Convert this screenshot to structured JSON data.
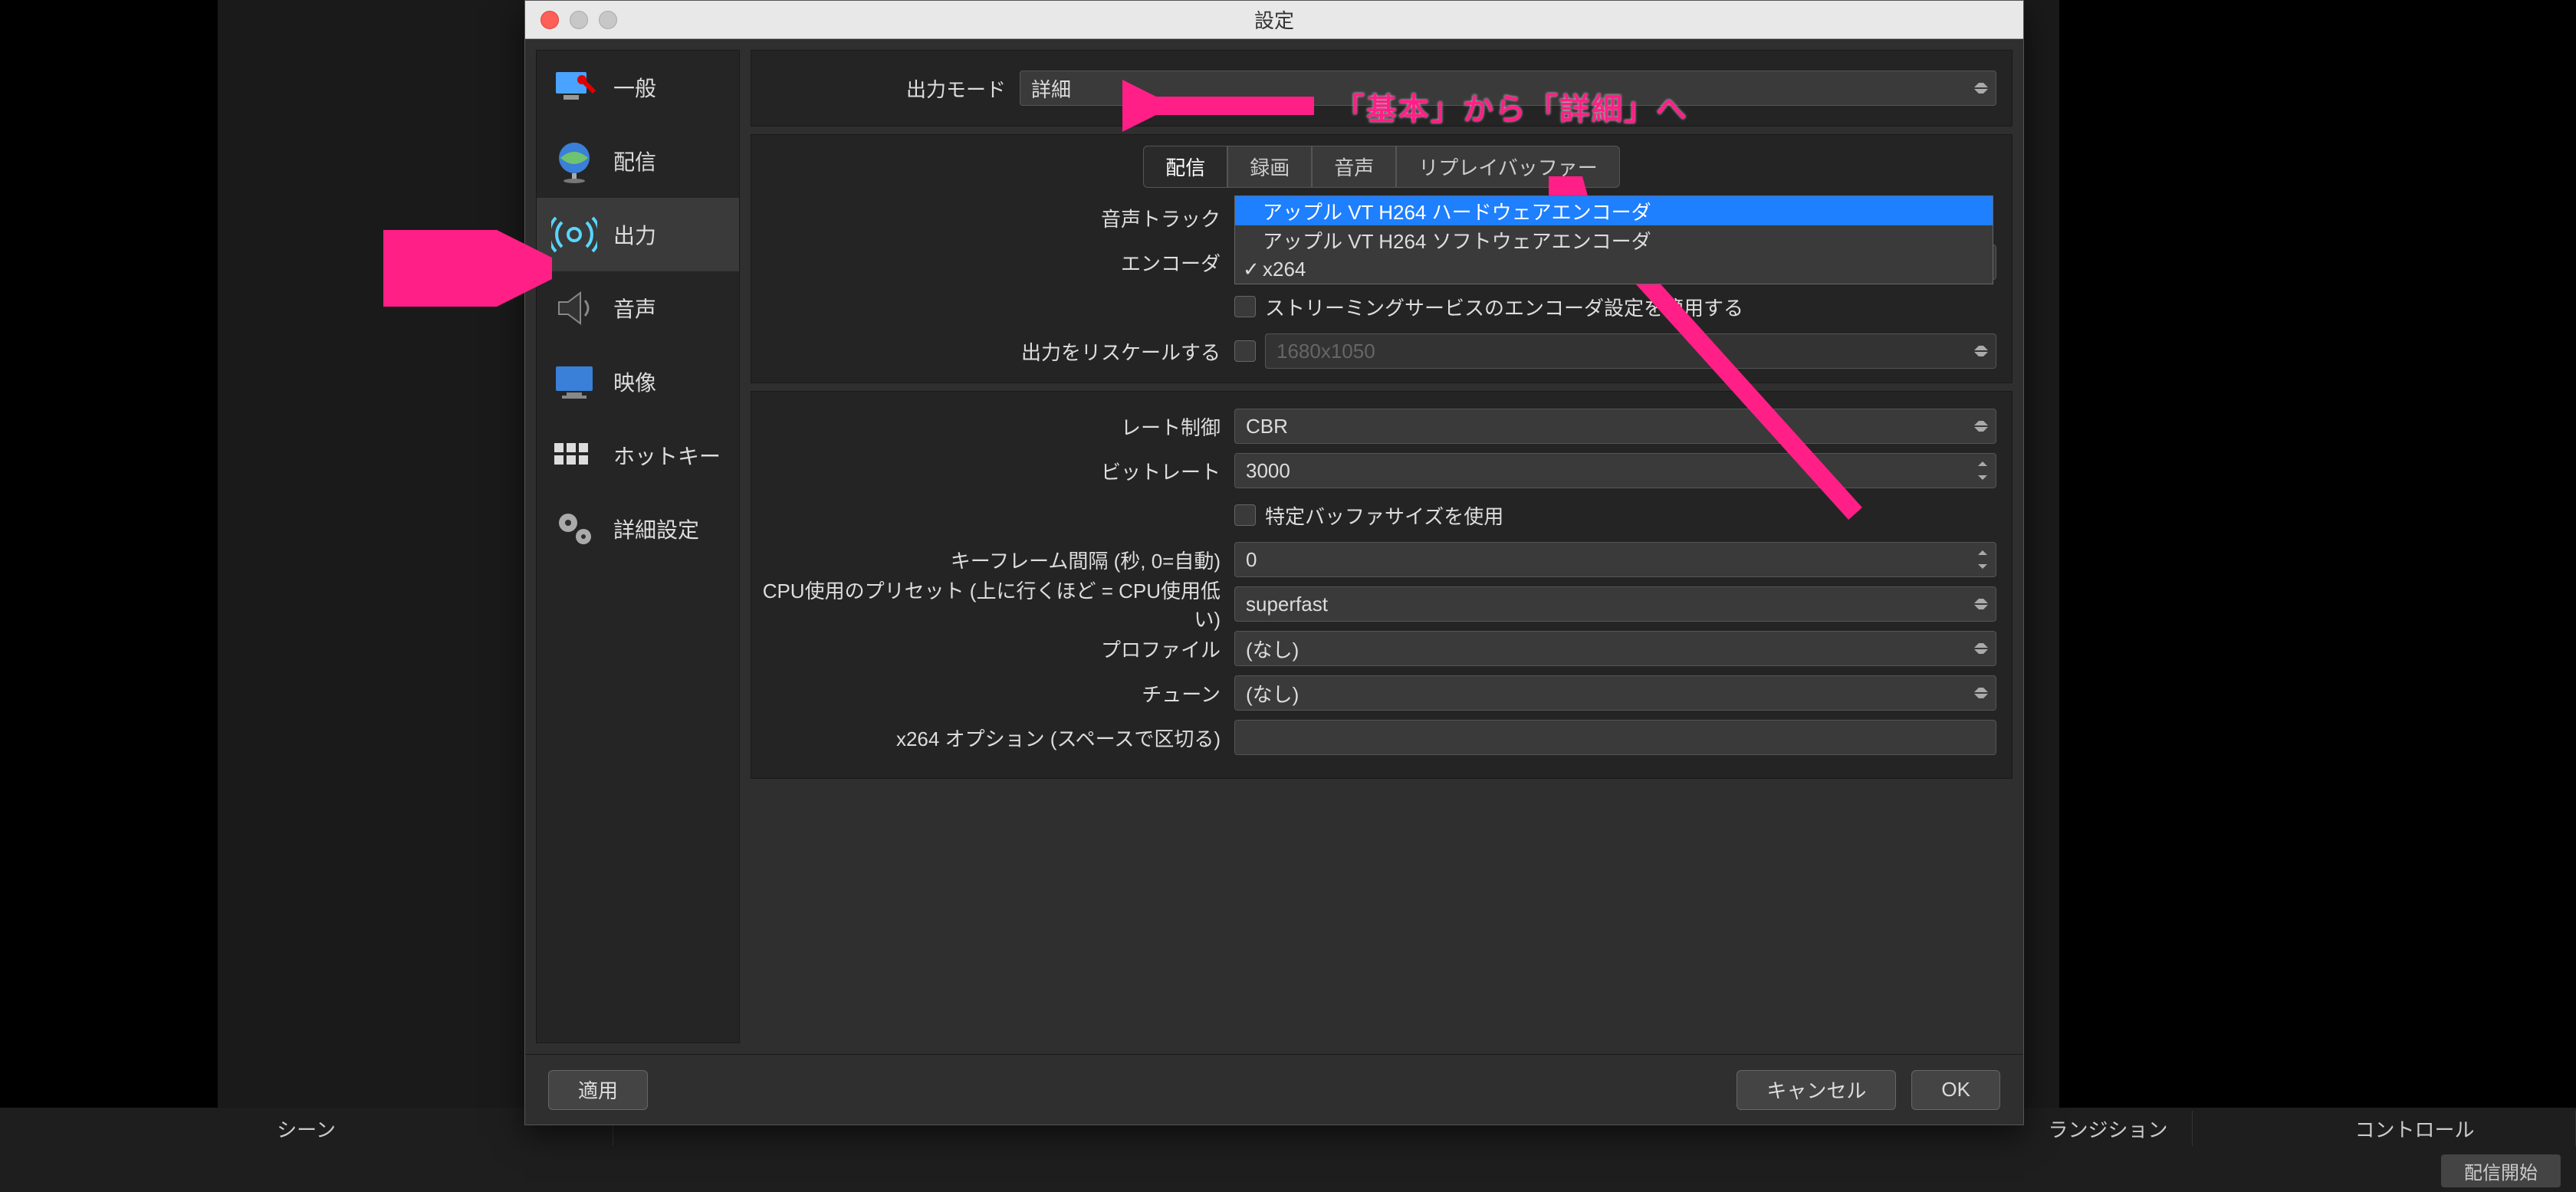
{
  "app_title": "設定",
  "sidebar": {
    "items": [
      {
        "label": "一般"
      },
      {
        "label": "配信"
      },
      {
        "label": "出力"
      },
      {
        "label": "音声"
      },
      {
        "label": "映像"
      },
      {
        "label": "ホットキー"
      },
      {
        "label": "詳細設定"
      }
    ]
  },
  "output_mode": {
    "label": "出力モード",
    "value": "詳細"
  },
  "tabs": {
    "stream": "配信",
    "record": "録画",
    "audio": "音声",
    "replay": "リプレイバッファー"
  },
  "form": {
    "audio_track_label": "音声トラック",
    "encoder_label": "エンコーダ",
    "encoder_options": [
      "アップル VT H264 ハードウェアエンコーダ",
      "アップル VT H264 ソフトウェアエンコーダ",
      "x264"
    ],
    "encoder_selected": "x264",
    "apply_service_settings": "ストリーミングサービスのエンコーダ設定を適用する",
    "rescale_label": "出力をリスケールする",
    "rescale_value": "1680x1050",
    "rate_control_label": "レート制御",
    "rate_control_value": "CBR",
    "bitrate_label": "ビットレート",
    "bitrate_value": "3000",
    "custom_buffer": "特定バッファサイズを使用",
    "keyframe_label": "キーフレーム間隔 (秒, 0=自動)",
    "keyframe_value": "0",
    "cpu_preset_label": "CPU使用のプリセット (上に行くほど = CPU使用低い)",
    "cpu_preset_value": "superfast",
    "profile_label": "プロファイル",
    "profile_value": "(なし)",
    "tune_label": "チューン",
    "tune_value": "(なし)",
    "x264opts_label": "x264 オプション (スペースで区切る)"
  },
  "footer": {
    "apply": "適用",
    "cancel": "キャンセル",
    "ok": "OK"
  },
  "bottom_bar": {
    "scene": "シーン",
    "transition": "ランジション",
    "control": "コントロール",
    "start_stream": "配信開始"
  },
  "annotations": {
    "output_mode_note": "「基本」から「詳細」へ"
  }
}
